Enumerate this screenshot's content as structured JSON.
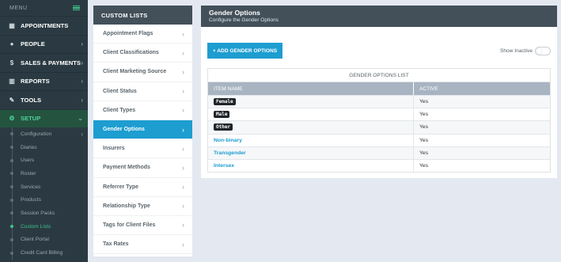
{
  "nav": {
    "menu_label": "MENU",
    "items": [
      {
        "label": "APPOINTMENTS",
        "icon": "calendar-icon",
        "has_arrow": false
      },
      {
        "label": "PEOPLE",
        "icon": "person-icon",
        "has_arrow": true
      },
      {
        "label": "SALES & PAYMENTS",
        "icon": "dollar-icon",
        "has_arrow": true
      },
      {
        "label": "REPORTS",
        "icon": "chart-icon",
        "has_arrow": true
      },
      {
        "label": "TOOLS",
        "icon": "wrench-icon",
        "has_arrow": true
      },
      {
        "label": "SETUP",
        "icon": "gear-icon",
        "has_arrow": true
      }
    ],
    "setup_sub": [
      "Configuration",
      "Diaries",
      "Users",
      "Roster",
      "Services",
      "Products",
      "Session Packs",
      "Custom Lists",
      "Client Portal",
      "Credit Card Billing"
    ]
  },
  "lists": {
    "title": "CUSTOM LISTS",
    "items": [
      "Appointment Flags",
      "Client Classifications",
      "Client Marketing Source",
      "Client Status",
      "Client Types",
      "Gender Options",
      "Insurers",
      "Payment Methods",
      "Referrer Type",
      "Relationship Type",
      "Tags for Client Files",
      "Tax Rates"
    ]
  },
  "main": {
    "title": "Gender Options",
    "subtitle": "Configure the Gender Options",
    "add_button": "+ ADD GENDER OPTIONS",
    "show_inactive": "Show Inactive",
    "table_caption": "GENDER OPTIONS LIST",
    "col_name": "ITEM NAME",
    "col_active": "ACTIVE",
    "rows": [
      {
        "name": "Female",
        "active": "Yes"
      },
      {
        "name": "Male",
        "active": "Yes"
      },
      {
        "name": "Other",
        "active": "Yes"
      },
      {
        "name": "Non-binary",
        "active": "Yes"
      },
      {
        "name": "Transgender",
        "active": "Yes"
      },
      {
        "name": "Intersex",
        "active": "Yes"
      }
    ]
  },
  "colors": {
    "accent": "#1d9dd0",
    "nav_bg": "#2b3a42",
    "setup_active": "#3fc38a"
  }
}
